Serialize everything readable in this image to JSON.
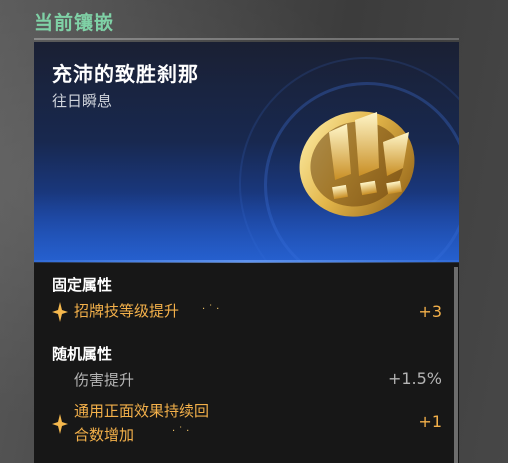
{
  "header": {
    "section_title": "当前镶嵌"
  },
  "card": {
    "name": "充沛的致胜刹那",
    "subtitle": "往日瞬息",
    "emblem_icon": "gold-exclamation-badge-icon"
  },
  "fixed_attributes": {
    "heading": "固定属性",
    "items": [
      {
        "label": "招牌技等级提升",
        "value": "+3",
        "icon": "gold-sparkle-icon"
      }
    ]
  },
  "random_attributes": {
    "heading": "随机属性",
    "items": [
      {
        "label": "伤害提升",
        "value": "+1.5%"
      },
      {
        "label_line1": "通用正面效果持续回",
        "label_line2": "合数增加",
        "value": "+1",
        "icon": "gold-sparkle-icon"
      }
    ]
  },
  "colors": {
    "section_title": "#7fd1a6",
    "highlight_gold": "#f3b04a",
    "banner_blue": "#1d4fb3",
    "panel_bg": "#171717"
  }
}
